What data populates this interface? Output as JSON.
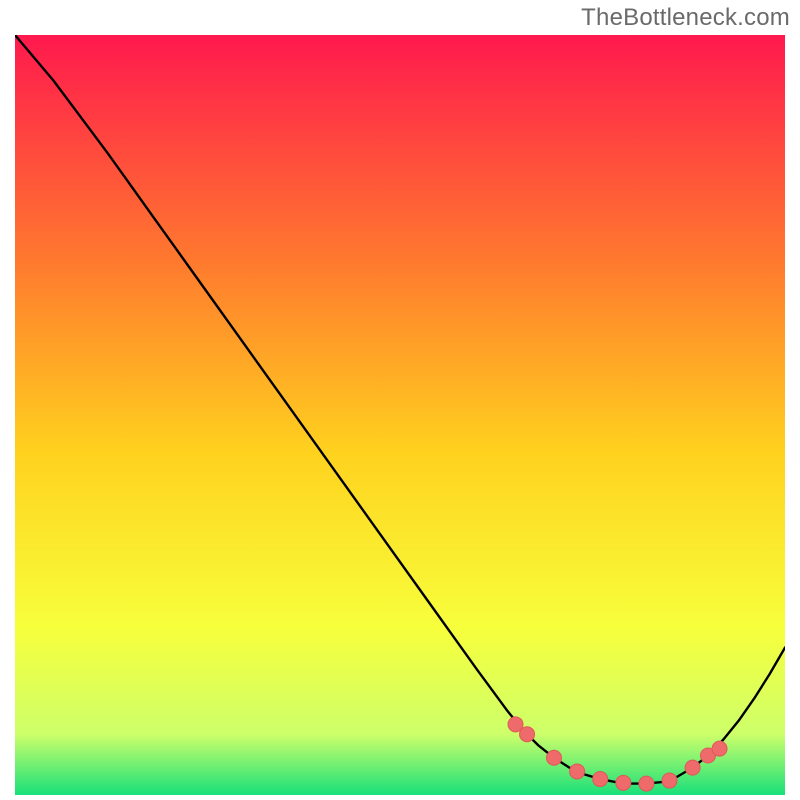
{
  "attribution": "TheBottleneck.com",
  "colors": {
    "gradient_top": "#ff194e",
    "gradient_mid1": "#ff7a2e",
    "gradient_mid2": "#ffd21e",
    "gradient_mid3": "#f7ff3c",
    "gradient_mid4": "#cdff6a",
    "gradient_bottom": "#18e07a",
    "line": "#000000",
    "marker": "#ef6b6b",
    "marker_stroke": "#e15757"
  },
  "chart_data": {
    "type": "line",
    "title": "",
    "xlabel": "",
    "ylabel": "",
    "xlim": [
      0,
      100
    ],
    "ylim": [
      0,
      100
    ],
    "series": [
      {
        "name": "bottleneck-curve",
        "x": [
          0,
          5,
          12,
          18,
          24,
          30,
          36,
          42,
          48,
          54,
          60,
          64,
          66,
          68,
          70,
          72,
          74,
          76,
          78,
          80,
          82,
          84,
          86,
          88,
          90,
          92,
          94,
          96,
          98,
          100
        ],
        "y": [
          100,
          94,
          84.5,
          76,
          67.5,
          59,
          50.5,
          42,
          33.5,
          25,
          16.5,
          11,
          8.5,
          6.5,
          4.9,
          3.6,
          2.7,
          2.1,
          1.7,
          1.5,
          1.5,
          1.7,
          2.4,
          3.6,
          5.2,
          7.3,
          9.8,
          12.7,
          15.9,
          19.4
        ]
      }
    ],
    "markers": {
      "name": "highlight-range",
      "x": [
        65,
        66.5,
        70,
        73,
        76,
        79,
        82,
        85,
        88,
        90,
        91.5
      ],
      "y": [
        9.3,
        8.0,
        4.9,
        3.1,
        2.1,
        1.6,
        1.5,
        1.9,
        3.6,
        5.2,
        6.1
      ]
    }
  }
}
